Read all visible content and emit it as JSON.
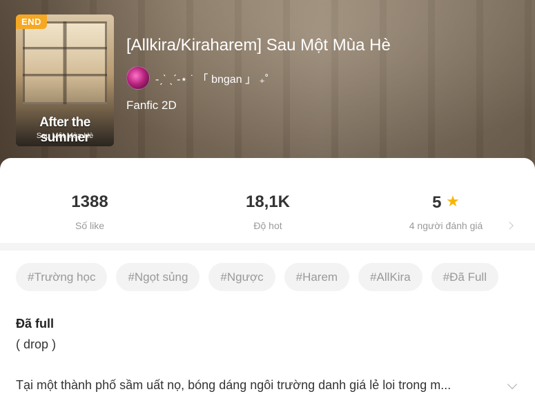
{
  "book": {
    "cover": {
      "badge": "END",
      "title": "After the summer",
      "subtitle": "Sau Một Mùa Hè"
    },
    "title": "[Allkira/Kiraharem] Sau Một Mùa Hè",
    "author": "-ˏˋ ˎˊ-⋆ ˙ 「 bngan 」 ₊˚",
    "category": "Fanfic 2D"
  },
  "stats": [
    {
      "value": "1388",
      "label": "Số like"
    },
    {
      "value": "18,1K",
      "label": "Độ hot"
    },
    {
      "value": "5",
      "label": "4 người đánh giá",
      "icon": "star-icon"
    }
  ],
  "tags": [
    "#Trường học",
    "#Ngọt sủng",
    "#Ngược",
    "#Harem",
    "#AllKira",
    "#Đã Full"
  ],
  "description": {
    "status": "Đã full",
    "note": "( drop )",
    "text": "Tại một thành phố sầm uất nọ, bóng dáng ngôi trường danh giá lẻ loi trong m..."
  },
  "colors": {
    "accent": "#f6a823",
    "star": "#f7b500"
  }
}
